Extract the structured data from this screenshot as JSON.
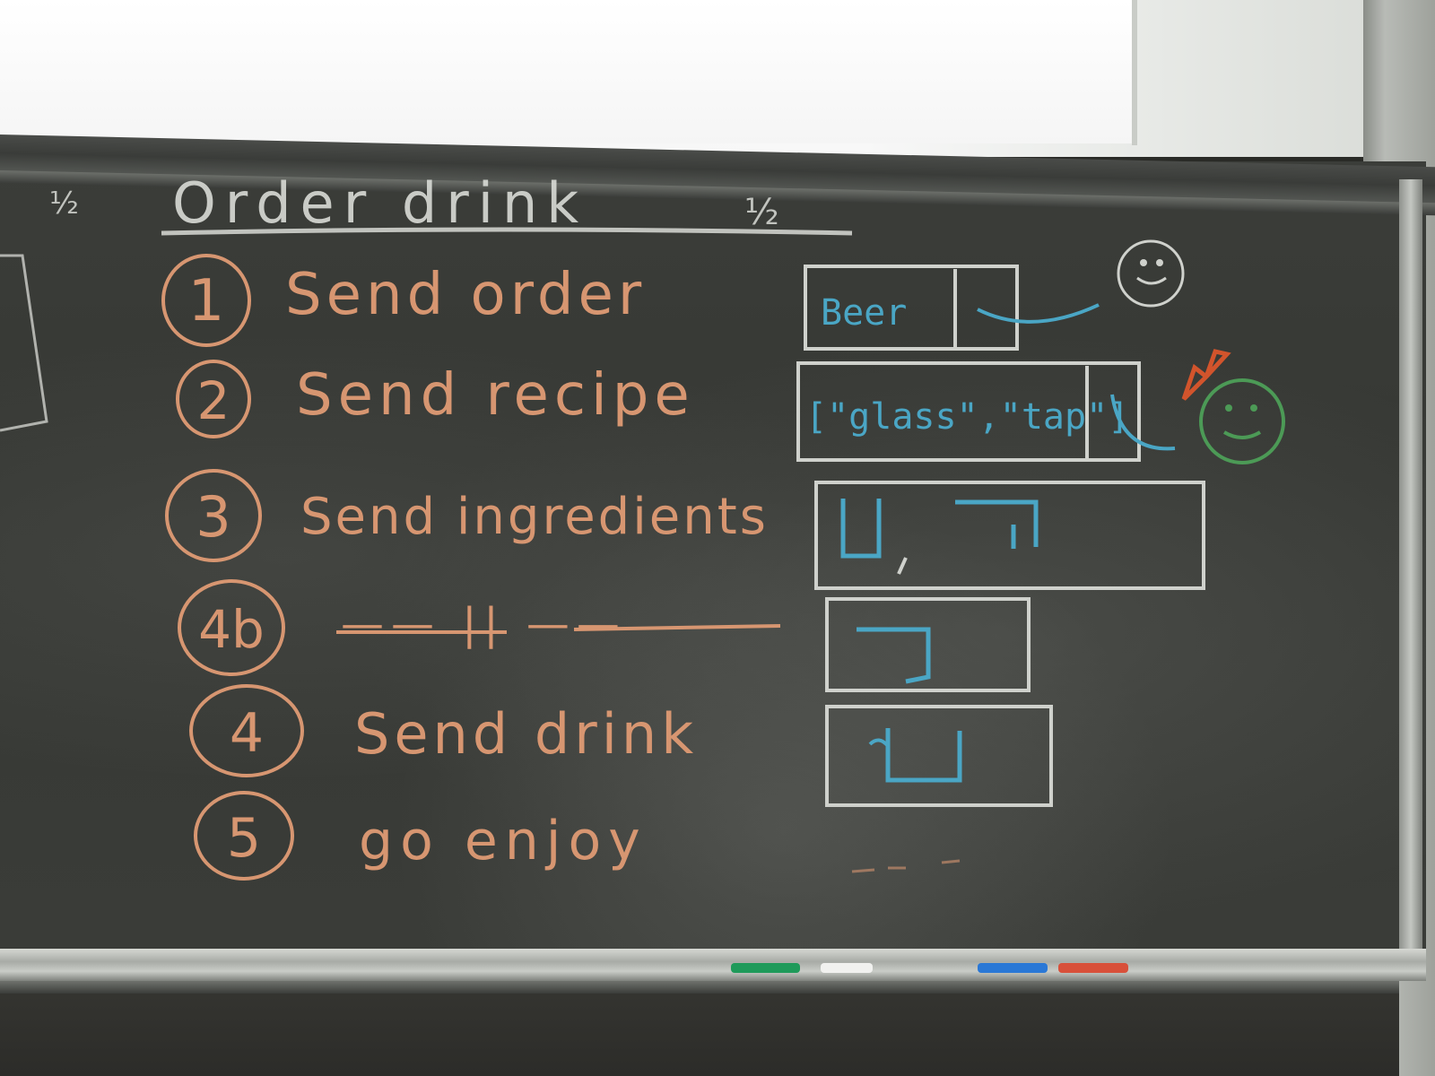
{
  "board": {
    "fraction_left": "½",
    "title": "Order drink",
    "fraction_right": "½",
    "steps": [
      {
        "num": "1",
        "label": "Send order"
      },
      {
        "num": "2",
        "label": "Send recipe"
      },
      {
        "num": "3",
        "label": "Send ingredients"
      },
      {
        "num": "4b",
        "label": "—— || ——"
      },
      {
        "num": "4",
        "label": "Send drink"
      },
      {
        "num": "5",
        "label": "go enjoy"
      }
    ],
    "boxes": {
      "order_text": "Beer",
      "recipe_text": "[\"glass\",\"tap\"]"
    },
    "markers": [
      "green-marker",
      "white-marker",
      "blue-marker",
      "red-marker"
    ],
    "colors": {
      "chalk_white": "#d9dbd6",
      "chalk_orange": "#d79671",
      "chalk_blue": "#4aa6c5",
      "chalk_green": "#4c9a56",
      "chalk_red": "#d2542c"
    }
  }
}
